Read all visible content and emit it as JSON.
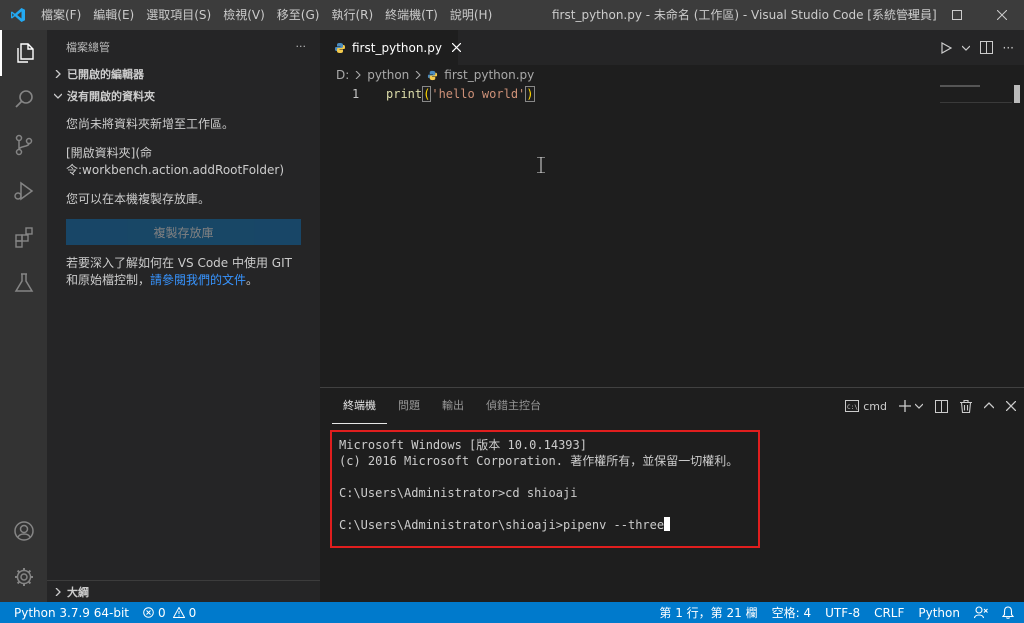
{
  "menu": [
    "檔案(F)",
    "編輯(E)",
    "選取項目(S)",
    "檢視(V)",
    "移至(G)",
    "執行(R)",
    "終端機(T)",
    "說明(H)"
  ],
  "window_title": "first_python.py - 未命名 (工作區) - Visual Studio Code [系統管理員]",
  "sidebar": {
    "header": "檔案總管",
    "more": "···",
    "open_editors": "已開啟的編輯器",
    "no_folder": "沒有開啟的資料夾",
    "text1": "您尚未將資料夾新增至工作區。",
    "text2a": "[開啟資料夾](命",
    "text2b": "令:workbench.action.addRootFolder)",
    "text3": "您可以在本機複製存放庫。",
    "clone_button": "複製存放庫",
    "text4a": "若要深入了解如何在 VS Code 中使用 GIT",
    "text4b": "和原始檔控制，",
    "text4_link": "請參閱我們的文件",
    "text4_end": "。",
    "outline": "大綱"
  },
  "editor": {
    "tab": "first_python.py",
    "breadcrumb": [
      "D:",
      "python",
      "first_python.py"
    ],
    "line_number": "1",
    "code": {
      "fn": "print",
      "open": "(",
      "str": "'hello world'",
      "close": ")"
    }
  },
  "panel": {
    "tabs": [
      "終端機",
      "問題",
      "輸出",
      "偵錯主控台"
    ],
    "terminal_name": "cmd",
    "terminal_lines": [
      "Microsoft Windows [版本 10.0.14393]",
      "(c) 2016 Microsoft Corporation. 著作權所有，並保留一切權利。",
      "",
      "C:\\Users\\Administrator>cd shioaji",
      "",
      "C:\\Users\\Administrator\\shioaji>pipenv --three"
    ]
  },
  "status": {
    "python": "Python 3.7.9 64-bit",
    "errors": "0",
    "warnings": "0",
    "position": "第 1 行，第 21 欄",
    "spaces": "空格: 4",
    "encoding": "UTF-8",
    "eol": "CRLF",
    "language": "Python"
  },
  "colors": {
    "statusbar": "#007acc",
    "accent": "#3794ff",
    "highlight_border": "#e01e1e"
  }
}
